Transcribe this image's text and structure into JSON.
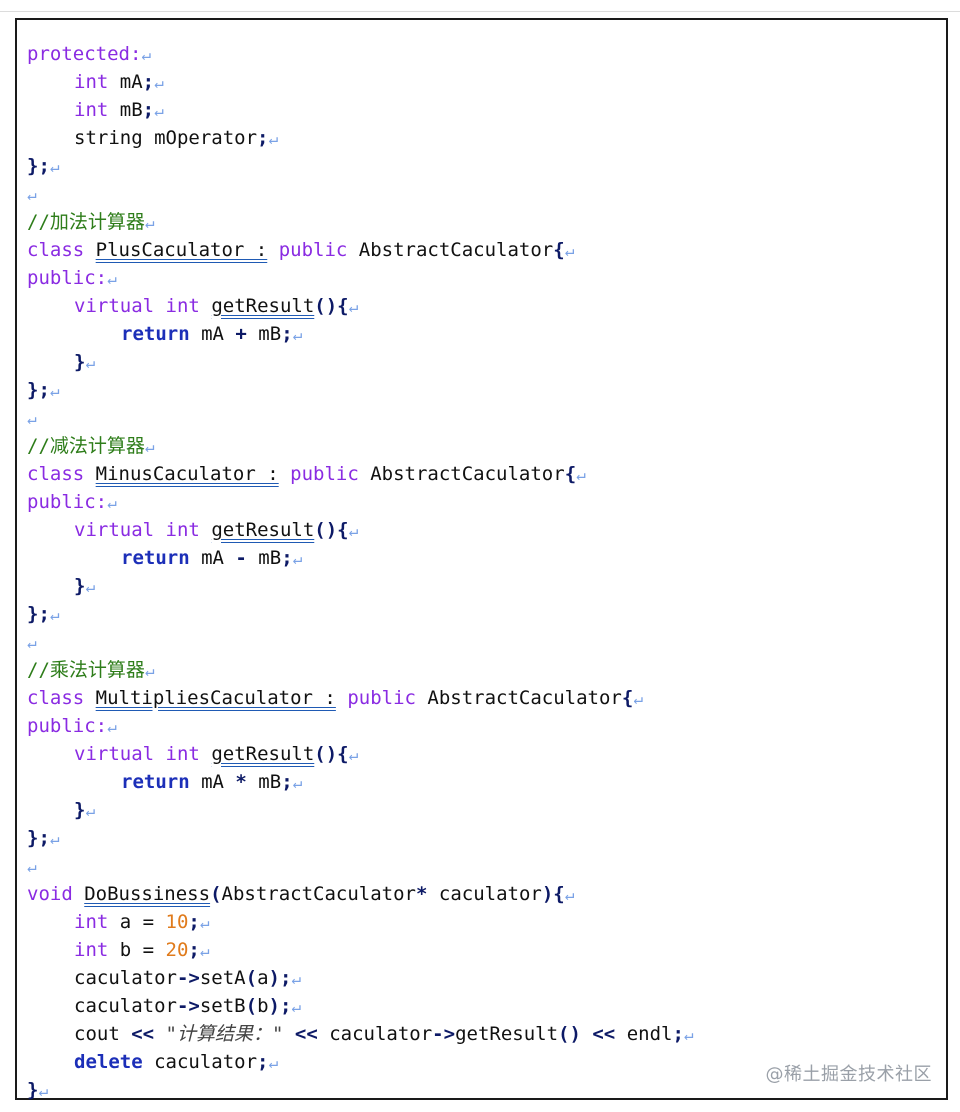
{
  "watermark": "@稀土掘金技术社区",
  "code": {
    "l1": "protected:",
    "l2_kw": "int",
    "l2_rest": " mA",
    "l3_kw": "int",
    "l3_rest": " mB",
    "l4": "string mOperator",
    "end_class": "};",
    "c1": "//加法计算器",
    "class_kw": "class",
    "public_kw": "public",
    "base": " AbstractCaculator",
    "plus_name": "PlusCaculator :",
    "public_colon": "public:",
    "virtual_kw": "virtual",
    "int_kw": "int",
    "getresult": "getResult",
    "return_kw": "return",
    "plus_expr_a": " mA ",
    "plus_op": "+",
    "expr_b": " mB",
    "close_brace": "}",
    "c2": "//减法计算器",
    "minus_name": "MinusCaculator :",
    "minus_op": "-",
    "c3": "//乘法计算器",
    "mult_name": "MultipliesCaculator :",
    "mult_op": "*",
    "void_kw": "void",
    "dobuss_name": "DoBussiness",
    "dobuss_param1": "AbstractCaculator",
    "dobuss_param2": " caculator",
    "a_decl": " a = ",
    "a_val": "10",
    "b_decl": " b = ",
    "b_val": "20",
    "set_a_obj": "caculator",
    "set_a_call": "setA",
    "set_a_arg": "a",
    "set_b_obj": "caculator",
    "set_b_call": "setB",
    "set_b_arg": "b",
    "cout": "cout ",
    "shl": "<<",
    "cout_str": "\"计算结果：\"",
    "cout_obj": " caculator",
    "cout_call": "getResult",
    "endl": " endl",
    "delete_kw": "delete",
    "delete_rest": " caculator",
    "final_brace": "}"
  }
}
